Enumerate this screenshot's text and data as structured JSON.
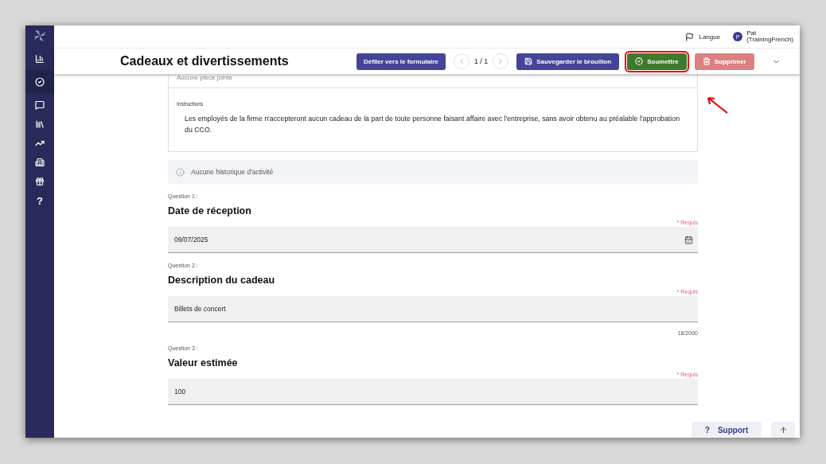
{
  "topbar": {
    "language": "Langue",
    "user_initial": "P",
    "user_name": "Pat",
    "user_org": "(TrainingFrench)"
  },
  "sidebar": {
    "items": [
      {
        "kind": "chart",
        "selected": false
      },
      {
        "kind": "check",
        "selected": true
      },
      {
        "kind": "chat",
        "selected": false
      },
      {
        "kind": "library",
        "selected": false
      },
      {
        "kind": "trend",
        "selected": false
      },
      {
        "kind": "building",
        "selected": false
      },
      {
        "kind": "gift",
        "selected": false
      },
      {
        "kind": "help",
        "label": "?",
        "selected": false
      }
    ]
  },
  "header": {
    "title": "Cadeaux et divertissements",
    "scroll_button": "Défiler vers le formulaire",
    "pager": "1 / 1",
    "actions": [
      {
        "kind": "save",
        "label": "Sauvegarder le brouillon",
        "disabled": false,
        "highlighted": false
      },
      {
        "kind": "submit",
        "label": "Soumettre",
        "disabled": false,
        "highlighted": true
      },
      {
        "kind": "delete",
        "label": "Supprimer",
        "disabled": true,
        "highlighted": false
      }
    ]
  },
  "attachments": {
    "text": "Aucune pièce jointe"
  },
  "instructions": {
    "label": "Instructions",
    "text": "Les employés de la firme n'accepteront aucun cadeau de la part de toute personne faisant affaire avec l'entreprise, sans avoir obtenu au préalable l'approbation du CCO."
  },
  "activity": {
    "text": "Aucune historique d'activité"
  },
  "questions": [
    {
      "number": "Question 1 :",
      "title": "Date de réception",
      "required": "* Requis",
      "kind": "date",
      "value": "09/07/2025"
    },
    {
      "number": "Question 2 :",
      "title": "Description du cadeau",
      "required": "* Requis",
      "kind": "text",
      "value": "Billets de concert",
      "counter": "18/2000"
    },
    {
      "number": "Question 3 :",
      "title": "Valeur estimée",
      "required": "* Requis",
      "kind": "text",
      "value": "100"
    }
  ],
  "support": {
    "icon": "?",
    "label": "Support"
  }
}
